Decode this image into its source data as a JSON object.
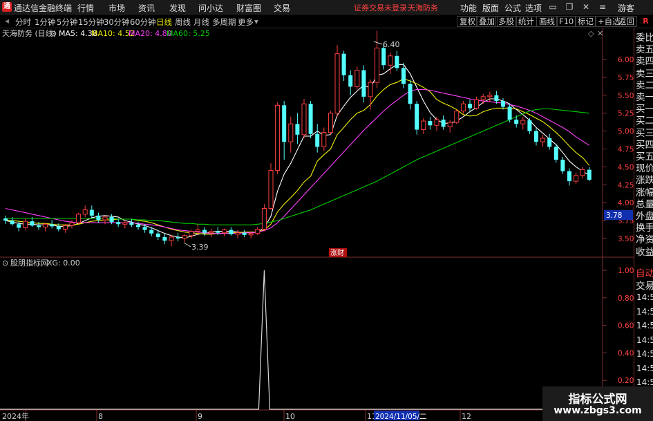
{
  "app": {
    "logo_text": "通",
    "name": "通达信金融终端"
  },
  "menu": [
    "行情",
    "市场",
    "资讯",
    "发现",
    "问小达",
    "财富圈",
    "交易"
  ],
  "status_notice": "证券交易未登录",
  "stock_title": "天海防务",
  "right_menu": [
    "功能",
    "版面",
    "公式",
    "选项"
  ],
  "guest_label": "游客",
  "periods": [
    "分时",
    "1分钟",
    "5分钟",
    "15分钟",
    "30分钟",
    "60分钟",
    "日线",
    "周线",
    "月线",
    "多周期",
    "更多"
  ],
  "active_period": "日线",
  "toolbar_buttons": [
    "复权",
    "叠加",
    "多股",
    "统计",
    "画线",
    "F10",
    "标记",
    "+自选",
    "返回"
  ],
  "side_button": "R",
  "main_info": {
    "name": "天海防务 (日线)",
    "ma5": "MA5: 4.38",
    "ma10": "MA10: 4.52",
    "ma20": "MA20: 4.80",
    "ma60": "MA60: 5.25"
  },
  "sub_info": {
    "name": "股朋指标网",
    "xg": "XG: 0.00"
  },
  "annotations": {
    "high": "6.40",
    "low": "3.39",
    "current_price": "3.78",
    "tag": "涨财"
  },
  "price_axis": [
    "6.00",
    "5.75",
    "5.50",
    "5.25",
    "5.00",
    "4.75",
    "4.50",
    "4.25",
    "4.00",
    "3.75",
    "3.50"
  ],
  "xg_axis": [
    "1.00",
    "0.80",
    "0.60",
    "0.40",
    "0.20"
  ],
  "date_axis": [
    "2024年",
    "8",
    "9",
    "10",
    "11",
    "2024/11/05/二",
    "12"
  ],
  "right_panel": {
    "labels": [
      "委比",
      "卖五",
      "卖四",
      "卖三",
      "卖二",
      "卖一",
      "买一",
      "买二",
      "买三",
      "买四",
      "买五",
      "现价",
      "涨跌",
      "涨幅",
      "总量",
      "外盘",
      "换手",
      "净资",
      "收益"
    ],
    "lower_labels": [
      "自动",
      "交易"
    ],
    "times": [
      "14:56",
      "14:56",
      "14:56",
      "14:56",
      "14:56",
      "14:56",
      "14:56",
      "14:56",
      "14:56"
    ]
  },
  "watermark": {
    "line1": "指标公式网",
    "line2": "www.zbgs3.com"
  },
  "colors": {
    "up": "#ff4040",
    "down": "#54ffff",
    "ma5": "#ffffff",
    "ma10": "#f0f000",
    "ma20": "#ff40ff",
    "ma60": "#00d000",
    "grid_red": "#803030"
  },
  "chart_data": {
    "type": "candlestick",
    "price_range": [
      3.3,
      6.55
    ],
    "candles": [
      [
        3.78,
        3.82,
        3.7,
        3.75
      ],
      [
        3.75,
        3.8,
        3.68,
        3.7
      ],
      [
        3.7,
        3.74,
        3.6,
        3.65
      ],
      [
        3.65,
        3.78,
        3.62,
        3.74
      ],
      [
        3.74,
        3.8,
        3.66,
        3.68
      ],
      [
        3.68,
        3.73,
        3.62,
        3.66
      ],
      [
        3.66,
        3.72,
        3.6,
        3.7
      ],
      [
        3.7,
        3.76,
        3.64,
        3.67
      ],
      [
        3.67,
        3.71,
        3.6,
        3.63
      ],
      [
        3.63,
        3.7,
        3.58,
        3.68
      ],
      [
        3.68,
        3.76,
        3.64,
        3.72
      ],
      [
        3.72,
        3.86,
        3.7,
        3.84
      ],
      [
        3.84,
        3.96,
        3.8,
        3.9
      ],
      [
        3.9,
        3.96,
        3.78,
        3.82
      ],
      [
        3.82,
        3.86,
        3.72,
        3.76
      ],
      [
        3.76,
        3.82,
        3.7,
        3.8
      ],
      [
        3.8,
        3.84,
        3.7,
        3.73
      ],
      [
        3.73,
        3.78,
        3.66,
        3.7
      ],
      [
        3.7,
        3.75,
        3.64,
        3.72
      ],
      [
        3.72,
        3.77,
        3.66,
        3.69
      ],
      [
        3.69,
        3.73,
        3.62,
        3.66
      ],
      [
        3.66,
        3.7,
        3.58,
        3.62
      ],
      [
        3.62,
        3.66,
        3.53,
        3.57
      ],
      [
        3.57,
        3.62,
        3.48,
        3.52
      ],
      [
        3.52,
        3.56,
        3.42,
        3.47
      ],
      [
        3.47,
        3.55,
        3.39,
        3.52
      ],
      [
        3.52,
        3.58,
        3.46,
        3.5
      ],
      [
        3.5,
        3.56,
        3.45,
        3.54
      ],
      [
        3.54,
        3.62,
        3.5,
        3.6
      ],
      [
        3.6,
        3.7,
        3.55,
        3.62
      ],
      [
        3.62,
        3.66,
        3.54,
        3.58
      ],
      [
        3.58,
        3.64,
        3.52,
        3.6
      ],
      [
        3.6,
        3.66,
        3.55,
        3.58
      ],
      [
        3.58,
        3.64,
        3.53,
        3.62
      ],
      [
        3.62,
        3.66,
        3.54,
        3.56
      ],
      [
        3.56,
        3.62,
        3.5,
        3.58
      ],
      [
        3.58,
        3.62,
        3.52,
        3.55
      ],
      [
        3.55,
        3.6,
        3.5,
        3.57
      ],
      [
        3.57,
        3.66,
        3.55,
        3.63
      ],
      [
        3.63,
        3.98,
        3.6,
        3.92
      ],
      [
        3.92,
        4.55,
        3.9,
        4.45
      ],
      [
        4.45,
        5.4,
        4.4,
        5.36
      ],
      [
        5.36,
        5.42,
        4.6,
        4.85
      ],
      [
        4.85,
        5.2,
        4.7,
        5.1
      ],
      [
        5.1,
        5.25,
        4.82,
        4.95
      ],
      [
        4.95,
        5.45,
        4.9,
        5.38
      ],
      [
        5.38,
        5.42,
        4.9,
        4.96
      ],
      [
        4.96,
        5.1,
        4.7,
        4.78
      ],
      [
        4.78,
        5.05,
        4.72,
        4.98
      ],
      [
        4.98,
        5.28,
        4.95,
        5.25
      ],
      [
        5.25,
        6.2,
        5.2,
        6.08
      ],
      [
        6.08,
        6.12,
        5.7,
        5.78
      ],
      [
        5.78,
        5.85,
        5.5,
        5.62
      ],
      [
        5.62,
        5.9,
        5.58,
        5.85
      ],
      [
        5.85,
        5.92,
        5.4,
        5.48
      ],
      [
        5.48,
        5.72,
        5.3,
        5.68
      ],
      [
        5.68,
        6.4,
        5.6,
        6.16
      ],
      [
        6.16,
        6.22,
        5.86,
        5.92
      ],
      [
        5.92,
        6.1,
        5.8,
        6.05
      ],
      [
        6.05,
        6.12,
        5.84,
        5.88
      ],
      [
        5.88,
        5.95,
        5.6,
        5.66
      ],
      [
        5.66,
        5.72,
        5.3,
        5.38
      ],
      [
        5.38,
        5.42,
        4.95,
        5.02
      ],
      [
        5.02,
        5.18,
        4.96,
        5.14
      ],
      [
        5.14,
        5.2,
        5.02,
        5.08
      ],
      [
        5.08,
        5.2,
        5.0,
        5.16
      ],
      [
        5.16,
        5.22,
        5.02,
        5.06
      ],
      [
        5.06,
        5.15,
        4.98,
        5.12
      ],
      [
        5.12,
        5.3,
        5.1,
        5.28
      ],
      [
        5.28,
        5.42,
        5.24,
        5.38
      ],
      [
        5.38,
        5.44,
        5.28,
        5.32
      ],
      [
        5.32,
        5.48,
        5.3,
        5.44
      ],
      [
        5.44,
        5.52,
        5.38,
        5.48
      ],
      [
        5.48,
        5.55,
        5.4,
        5.5
      ],
      [
        5.5,
        5.56,
        5.38,
        5.42
      ],
      [
        5.42,
        5.46,
        5.3,
        5.34
      ],
      [
        5.34,
        5.38,
        5.12,
        5.16
      ],
      [
        5.16,
        5.22,
        5.05,
        5.1
      ],
      [
        5.1,
        5.2,
        5.02,
        5.15
      ],
      [
        5.15,
        5.18,
        4.96,
        5.0
      ],
      [
        5.0,
        5.04,
        4.8,
        4.85
      ],
      [
        4.85,
        4.95,
        4.78,
        4.9
      ],
      [
        4.9,
        4.96,
        4.74,
        4.78
      ],
      [
        4.78,
        4.82,
        4.56,
        4.6
      ],
      [
        4.6,
        4.64,
        4.4,
        4.44
      ],
      [
        4.44,
        4.48,
        4.24,
        4.3
      ],
      [
        4.3,
        4.42,
        4.26,
        4.38
      ],
      [
        4.38,
        4.5,
        4.34,
        4.46
      ],
      [
        4.46,
        4.5,
        4.3,
        4.32
      ]
    ],
    "ma": [
      {
        "name": "MA5",
        "color": "#ffffff",
        "values": [
          3.75,
          3.73,
          3.71,
          3.7,
          3.7,
          3.69,
          3.69,
          3.69,
          3.67,
          3.67,
          3.68,
          3.71,
          3.75,
          3.79,
          3.81,
          3.82,
          3.81,
          3.8,
          3.75,
          3.73,
          3.7,
          3.68,
          3.65,
          3.61,
          3.57,
          3.54,
          3.52,
          3.51,
          3.53,
          3.56,
          3.57,
          3.59,
          3.6,
          3.6,
          3.6,
          3.59,
          3.58,
          3.58,
          3.59,
          3.65,
          3.81,
          4.16,
          4.4,
          4.55,
          4.74,
          4.93,
          4.93,
          5.0,
          4.94,
          4.95,
          5.22,
          5.35,
          5.47,
          5.56,
          5.64,
          5.6,
          5.78,
          5.8,
          5.87,
          5.93,
          5.93,
          5.8,
          5.61,
          5.42,
          5.26,
          5.16,
          5.11,
          5.11,
          5.14,
          5.2,
          5.27,
          5.33,
          5.4,
          5.45,
          5.45,
          5.42,
          5.38,
          5.3,
          5.23,
          5.15,
          5.05,
          4.97,
          4.89,
          4.81,
          4.7,
          4.58,
          4.5,
          4.44,
          4.38
        ]
      },
      {
        "name": "MA10",
        "color": "#f0f000",
        "values": [
          3.76,
          3.75,
          3.74,
          3.73,
          3.72,
          3.71,
          3.71,
          3.7,
          3.69,
          3.69,
          3.69,
          3.7,
          3.72,
          3.74,
          3.75,
          3.76,
          3.76,
          3.77,
          3.77,
          3.77,
          3.75,
          3.74,
          3.72,
          3.69,
          3.66,
          3.63,
          3.61,
          3.59,
          3.58,
          3.57,
          3.56,
          3.56,
          3.57,
          3.57,
          3.58,
          3.58,
          3.59,
          3.59,
          3.59,
          3.62,
          3.7,
          3.87,
          3.98,
          4.07,
          4.17,
          4.29,
          4.37,
          4.58,
          4.67,
          4.75,
          4.95,
          5.05,
          5.16,
          5.25,
          5.29,
          5.37,
          5.49,
          5.58,
          5.65,
          5.68,
          5.73,
          5.7,
          5.66,
          5.61,
          5.55,
          5.44,
          5.39,
          5.35,
          5.3,
          5.23,
          5.21,
          5.22,
          5.27,
          5.3,
          5.32,
          5.32,
          5.32,
          5.31,
          5.27,
          5.23,
          5.18,
          5.13,
          5.06,
          4.98,
          4.89,
          4.79,
          4.7,
          4.63,
          4.52
        ]
      },
      {
        "name": "MA20",
        "color": "#ff40ff",
        "values": [
          3.92,
          3.9,
          3.88,
          3.86,
          3.84,
          3.82,
          3.8,
          3.78,
          3.76,
          3.74,
          3.73,
          3.72,
          3.72,
          3.72,
          3.72,
          3.72,
          3.72,
          3.72,
          3.72,
          3.72,
          3.71,
          3.7,
          3.69,
          3.68,
          3.66,
          3.64,
          3.62,
          3.61,
          3.6,
          3.59,
          3.58,
          3.57,
          3.57,
          3.57,
          3.57,
          3.57,
          3.58,
          3.58,
          3.59,
          3.61,
          3.65,
          3.72,
          3.81,
          3.91,
          4.01,
          4.11,
          4.21,
          4.31,
          4.41,
          4.51,
          4.61,
          4.71,
          4.81,
          4.91,
          5.01,
          5.1,
          5.19,
          5.28,
          5.36,
          5.43,
          5.5,
          5.56,
          5.58,
          5.58,
          5.57,
          5.55,
          5.53,
          5.51,
          5.49,
          5.47,
          5.45,
          5.43,
          5.42,
          5.41,
          5.4,
          5.39,
          5.37,
          5.35,
          5.32,
          5.29,
          5.25,
          5.2,
          5.15,
          5.1,
          5.05,
          4.99,
          4.92,
          4.86,
          4.8
        ]
      },
      {
        "name": "MA60",
        "color": "#00d000",
        "values": [
          3.78,
          3.78,
          3.78,
          3.78,
          3.78,
          3.78,
          3.78,
          3.78,
          3.78,
          3.78,
          3.78,
          3.78,
          3.78,
          3.78,
          3.78,
          3.78,
          3.78,
          3.77,
          3.77,
          3.77,
          3.76,
          3.76,
          3.75,
          3.75,
          3.74,
          3.73,
          3.72,
          3.71,
          3.71,
          3.7,
          3.7,
          3.69,
          3.69,
          3.69,
          3.69,
          3.69,
          3.69,
          3.69,
          3.7,
          3.71,
          3.73,
          3.75,
          3.78,
          3.81,
          3.84,
          3.87,
          3.9,
          3.94,
          3.98,
          4.02,
          4.06,
          4.1,
          4.14,
          4.18,
          4.22,
          4.26,
          4.3,
          4.35,
          4.4,
          4.45,
          4.5,
          4.55,
          4.6,
          4.64,
          4.68,
          4.72,
          4.76,
          4.8,
          4.84,
          4.88,
          4.92,
          4.96,
          5.0,
          5.04,
          5.08,
          5.12,
          5.16,
          5.2,
          5.24,
          5.28,
          5.3,
          5.31,
          5.31,
          5.3,
          5.29,
          5.28,
          5.27,
          5.26,
          5.25
        ]
      }
    ],
    "xg": {
      "name": "XG",
      "spike_index": 39,
      "spike_value": 1.0,
      "range": [
        0,
        1.05
      ]
    }
  }
}
